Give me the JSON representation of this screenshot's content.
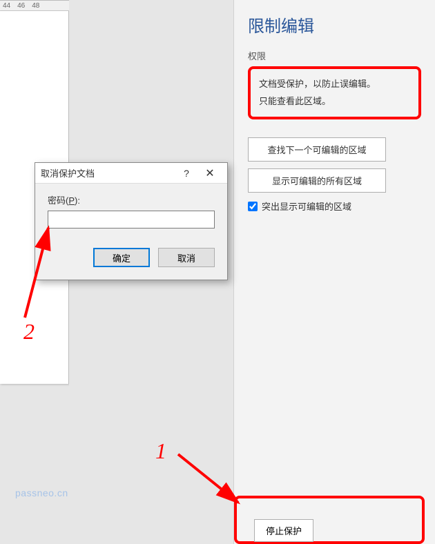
{
  "ruler": {
    "m44": "44",
    "m46": "46",
    "m48": "48"
  },
  "pane": {
    "title": "限制编辑",
    "section": "权限",
    "info_line1": "文档受保护，以防止误编辑。",
    "info_line2": "只能查看此区域。",
    "btn_find_next": "查找下一个可编辑的区域",
    "btn_show_all": "显示可编辑的所有区域",
    "chk_highlight": "突出显示可编辑的区域",
    "stop_protect": "停止保护"
  },
  "dialog": {
    "title": "取消保护文档",
    "help": "?",
    "password_label_prefix": "密码(",
    "password_label_key": "P",
    "password_label_suffix": "):",
    "ok": "确定",
    "cancel": "取消"
  },
  "anno": {
    "num1": "1",
    "num2": "2"
  },
  "watermark": "passneo.cn"
}
